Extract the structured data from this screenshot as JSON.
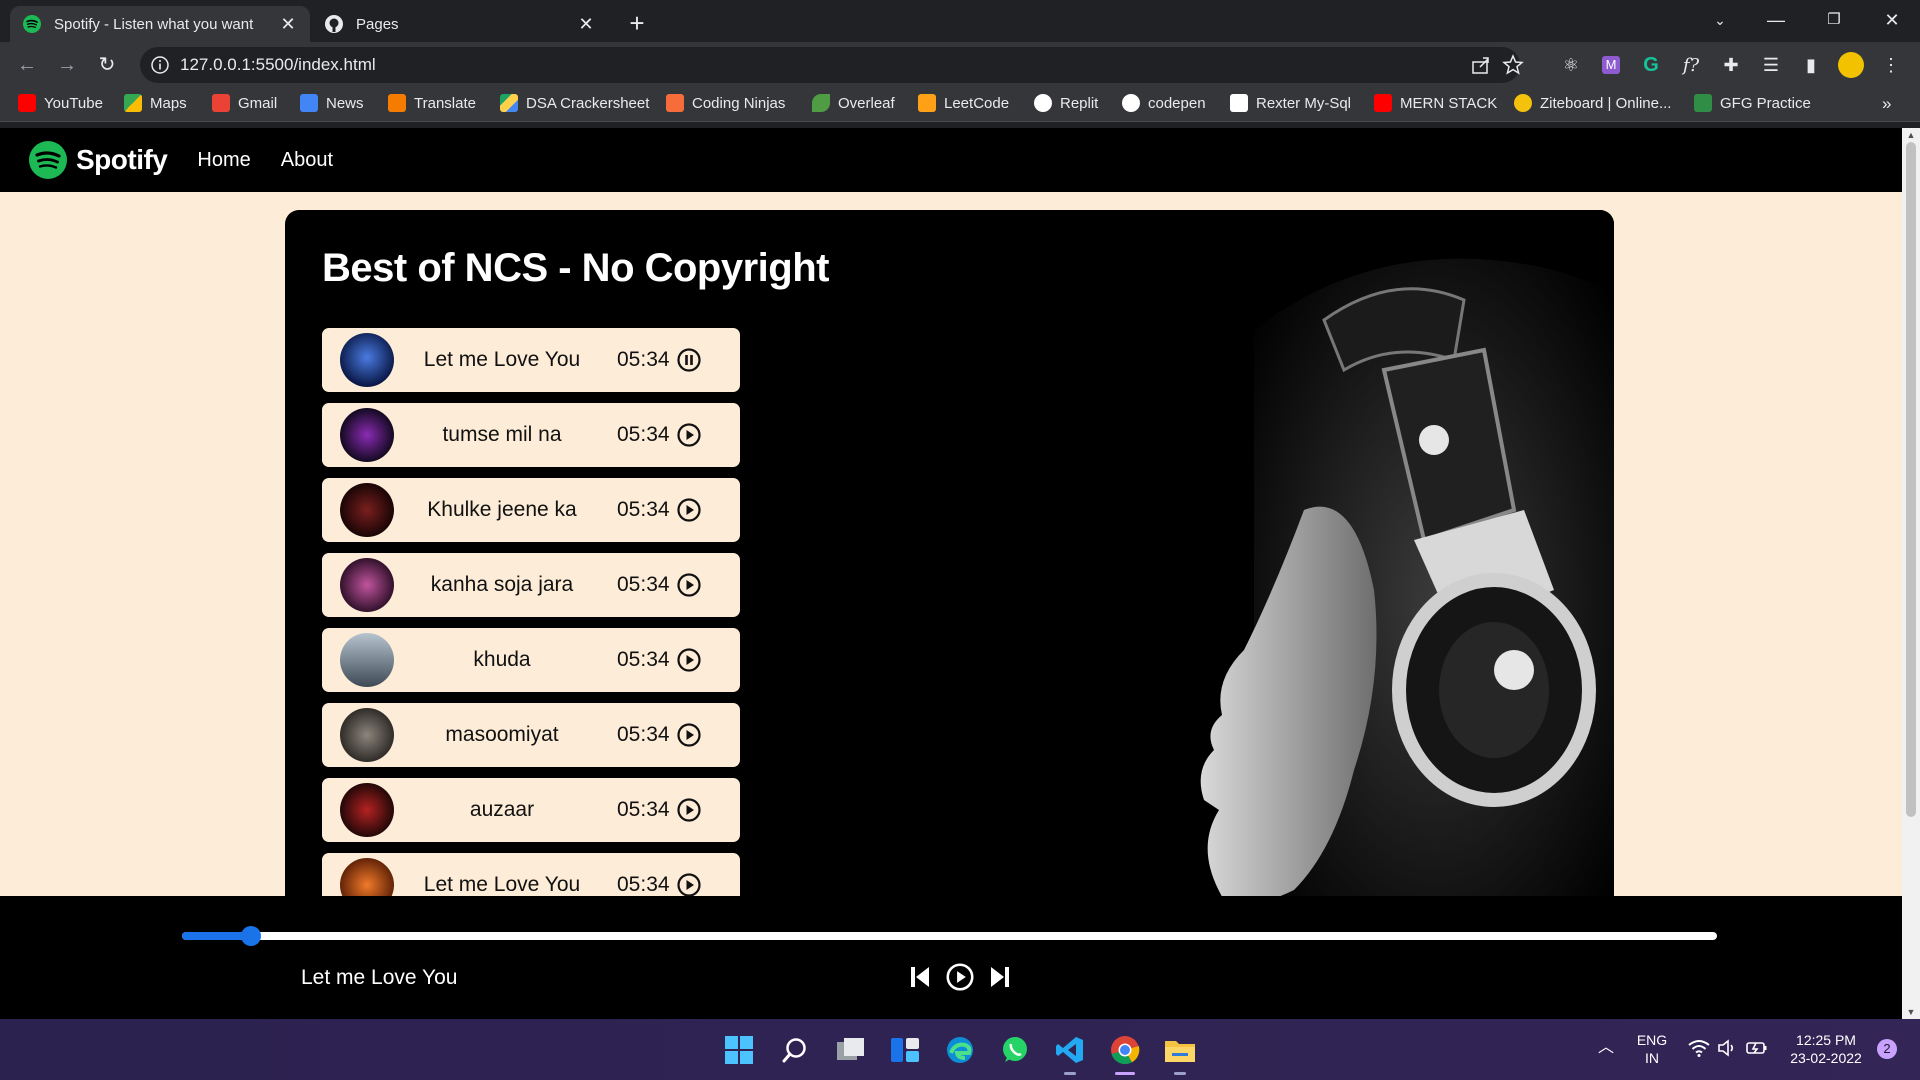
{
  "browser": {
    "tabs": [
      {
        "title": "Spotify - Listen what you want",
        "active": true,
        "icon": "spotify-icon"
      },
      {
        "title": "Pages",
        "active": false,
        "icon": "github-icon"
      }
    ],
    "url": "127.0.0.1:5500/index.html",
    "bookmarks": [
      {
        "label": "YouTube",
        "icon": "youtube-icon",
        "color": "#ff0000"
      },
      {
        "label": "Maps",
        "icon": "maps-icon",
        "color": "#34a853"
      },
      {
        "label": "Gmail",
        "icon": "gmail-icon",
        "color": "#ea4335"
      },
      {
        "label": "News",
        "icon": "news-icon",
        "color": "#4285f4"
      },
      {
        "label": "Translate",
        "icon": "translate-icon",
        "color": "#f57c00"
      },
      {
        "label": "DSA Crackersheet",
        "icon": "drive-icon",
        "color": "#1fa463"
      },
      {
        "label": "Coding Ninjas",
        "icon": "coding-ninjas-icon",
        "color": "#f66c3b"
      },
      {
        "label": "Overleaf",
        "icon": "overleaf-icon",
        "color": "#4f9c45"
      },
      {
        "label": "LeetCode",
        "icon": "leetcode-icon",
        "color": "#ffa116"
      },
      {
        "label": "Replit",
        "icon": "replit-icon",
        "color": "#ffffff"
      },
      {
        "label": "codepen",
        "icon": "codepen-icon",
        "color": "#ffffff"
      },
      {
        "label": "Rexter My-Sql",
        "icon": "rexter-icon",
        "color": "#ffffff"
      },
      {
        "label": "MERN STACK",
        "icon": "youtube-icon",
        "color": "#ff0000"
      },
      {
        "label": "Ziteboard | Online...",
        "icon": "ziteboard-icon",
        "color": "#f4c20d"
      },
      {
        "label": "GFG Practice",
        "icon": "gfg-icon",
        "color": "#2f8d46"
      }
    ],
    "more_bookmarks": "»"
  },
  "site": {
    "brand": "Spotify",
    "nav": [
      "Home",
      "About"
    ],
    "heading": "Best of NCS - No Copyright",
    "songs": [
      {
        "name": "Let me Love You",
        "time": "05:34",
        "state": "pause",
        "cover": "#1f3a8a"
      },
      {
        "name": "tumse mil na",
        "time": "05:34",
        "state": "play",
        "cover": "#2a1640"
      },
      {
        "name": "Khulke jeene ka",
        "time": "05:34",
        "state": "play",
        "cover": "#3b0a0a"
      },
      {
        "name": "kanha soja jara",
        "time": "05:34",
        "state": "play",
        "cover": "#6b2a5a"
      },
      {
        "name": "khuda",
        "time": "05:34",
        "state": "play",
        "cover": "#6c7f8f"
      },
      {
        "name": "masoomiyat",
        "time": "05:34",
        "state": "play",
        "cover": "#5a554e"
      },
      {
        "name": "auzaar",
        "time": "05:34",
        "state": "play",
        "cover": "#5a1010"
      },
      {
        "name": "Let me Love You",
        "time": "05:34",
        "state": "play",
        "cover": "#d9621c"
      }
    ],
    "now_playing": "Let me Love You",
    "progress": 0.045,
    "accent": "#1a73e8"
  },
  "taskbar": {
    "lang": "ENG",
    "region": "IN",
    "time": "12:25 PM",
    "date": "23-02-2022",
    "notifications": "2"
  }
}
